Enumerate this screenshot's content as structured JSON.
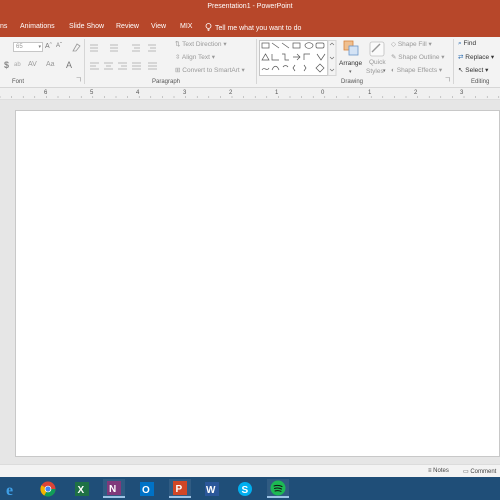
{
  "window": {
    "title": "Presentation1 - PowerPoint"
  },
  "tabs": [
    {
      "label": "ns"
    },
    {
      "label": "Animations"
    },
    {
      "label": "Slide Show"
    },
    {
      "label": "Review"
    },
    {
      "label": "View"
    },
    {
      "label": "MIX"
    }
  ],
  "tell_me": "Tell me what you want to do",
  "ribbon": {
    "font_size_value": "65",
    "groups": {
      "font": "Font",
      "paragraph": "Paragraph",
      "drawing": "Drawing",
      "editing": "Editing"
    },
    "text_direction": "Text Direction",
    "align_text": "Align Text",
    "convert_smartart": "Convert to SmartArt",
    "arrange": "Arrange",
    "quick_styles_1": "Quick",
    "quick_styles_2": "Styles",
    "shape_fill": "Shape Fill",
    "shape_outline": "Shape Outline",
    "shape_effects": "Shape Effects",
    "find": "Find",
    "replace": "Replace",
    "select": "Select"
  },
  "ruler": [
    "6",
    "5",
    "4",
    "3",
    "2",
    "1",
    "0",
    "1",
    "2",
    "3"
  ],
  "statusbar": {
    "notes": "Notes",
    "comments": "Comment"
  },
  "taskbar": {
    "apps": [
      "internet-explorer",
      "chrome",
      "excel",
      "onenote",
      "outlook",
      "powerpoint",
      "word",
      "skype",
      "spotify"
    ]
  },
  "colors": {
    "accent": "#b7472a",
    "taskbar": "#1f4e78"
  }
}
